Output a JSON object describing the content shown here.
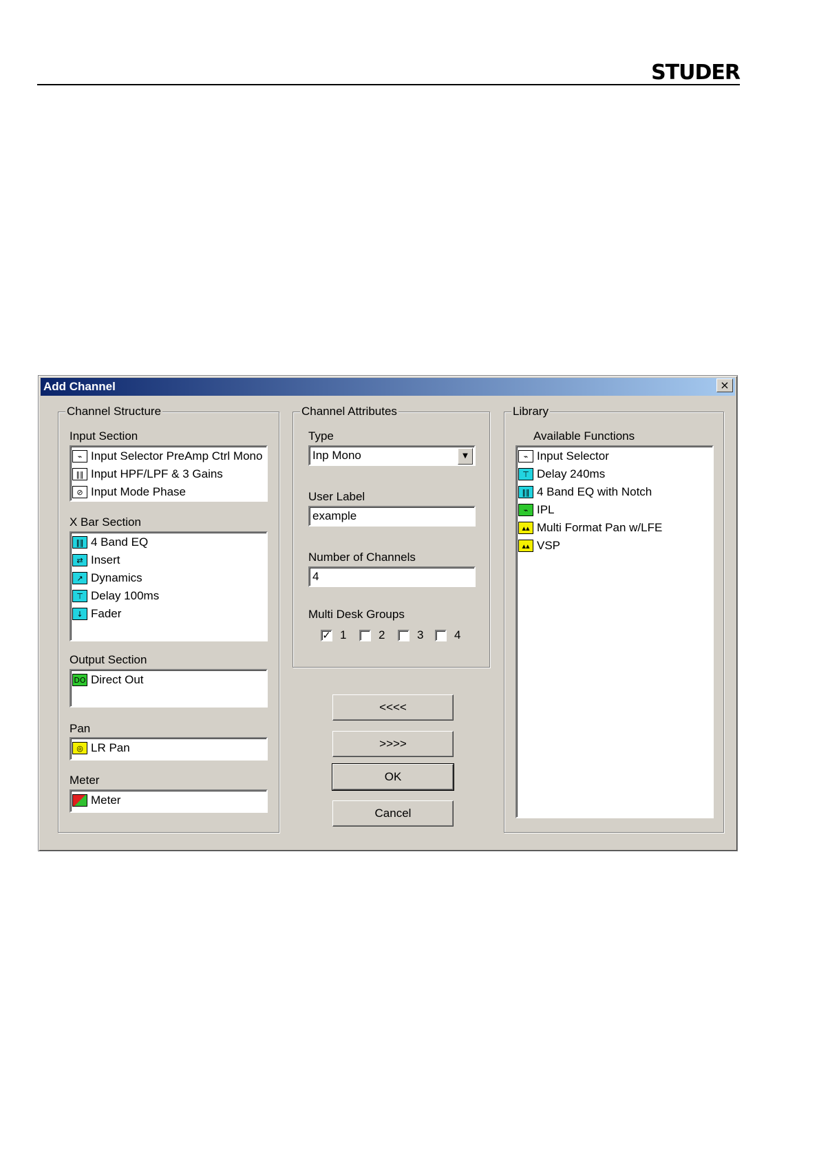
{
  "header": {
    "logo": "STUDER"
  },
  "dialog": {
    "title": "Add Channel",
    "close_label": "×",
    "channel_structure": {
      "legend": "Channel Structure",
      "input_section": {
        "label": "Input Section",
        "items": [
          {
            "label": "Input Selector PreAmp Ctrl Mono",
            "icon": "input-selector-icon"
          },
          {
            "label": "Input HPF/LPF & 3 Gains",
            "icon": "eq-sliders-icon"
          },
          {
            "label": "Input Mode Phase",
            "icon": "phase-icon"
          }
        ]
      },
      "xbar_section": {
        "label": "X Bar Section",
        "items": [
          {
            "label": "4 Band EQ",
            "icon": "eq-sliders-icon"
          },
          {
            "label": "Insert",
            "icon": "insert-icon"
          },
          {
            "label": "Dynamics",
            "icon": "dynamics-icon"
          },
          {
            "label": "Delay 100ms",
            "icon": "delay-icon"
          },
          {
            "label": "Fader",
            "icon": "fader-icon"
          }
        ]
      },
      "output_section": {
        "label": "Output Section",
        "items": [
          {
            "label": "Direct Out",
            "icon": "direct-out-icon"
          }
        ]
      },
      "pan": {
        "label": "Pan",
        "items": [
          {
            "label": "LR Pan",
            "icon": "pan-icon"
          }
        ]
      },
      "meter": {
        "label": "Meter",
        "items": [
          {
            "label": "Meter",
            "icon": "meter-icon"
          }
        ]
      }
    },
    "channel_attributes": {
      "legend": "Channel Attributes",
      "type_label": "Type",
      "type_value": "Inp Mono",
      "user_label_label": "User Label",
      "user_label_value": "example",
      "num_channels_label": "Number of Channels",
      "num_channels_value": "4",
      "multi_desk_label": "Multi Desk Groups",
      "groups": [
        {
          "label": "1",
          "checked": true
        },
        {
          "label": "2",
          "checked": false
        },
        {
          "label": "3",
          "checked": false
        },
        {
          "label": "4",
          "checked": false
        }
      ]
    },
    "buttons": {
      "remove": "<<<<",
      "add": ">>>>",
      "ok": "OK",
      "cancel": "Cancel"
    },
    "library": {
      "legend": "Library",
      "available_label": "Available Functions",
      "items": [
        {
          "label": "Input Selector",
          "icon": "input-selector-icon"
        },
        {
          "label": "Delay 240ms",
          "icon": "delay-icon"
        },
        {
          "label": "4 Band EQ with Notch",
          "icon": "eq-sliders-icon"
        },
        {
          "label": "IPL",
          "icon": "ipl-icon"
        },
        {
          "label": "Multi Format Pan w/LFE",
          "icon": "multi-pan-icon"
        },
        {
          "label": "VSP",
          "icon": "vsp-icon"
        }
      ]
    }
  }
}
